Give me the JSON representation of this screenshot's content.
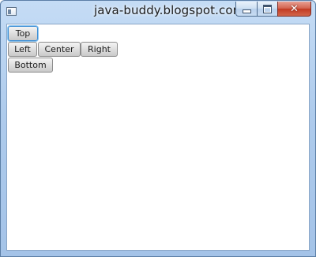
{
  "window": {
    "title": "java-buddy.blogspot.com:",
    "close_glyph": "✕"
  },
  "pane": {
    "top_label": "Top",
    "left_label": "Left",
    "center_label": "Center",
    "right_label": "Right",
    "bottom_label": "Bottom",
    "focused": "Top"
  },
  "colors": {
    "titlebar": "#aecbec",
    "close_button": "#c23a22",
    "focus_ring": "#3c8fd6"
  },
  "icons": {
    "app": "app-window-icon",
    "minimize": "minimize-icon",
    "maximize": "maximize-icon",
    "close": "close-icon"
  }
}
